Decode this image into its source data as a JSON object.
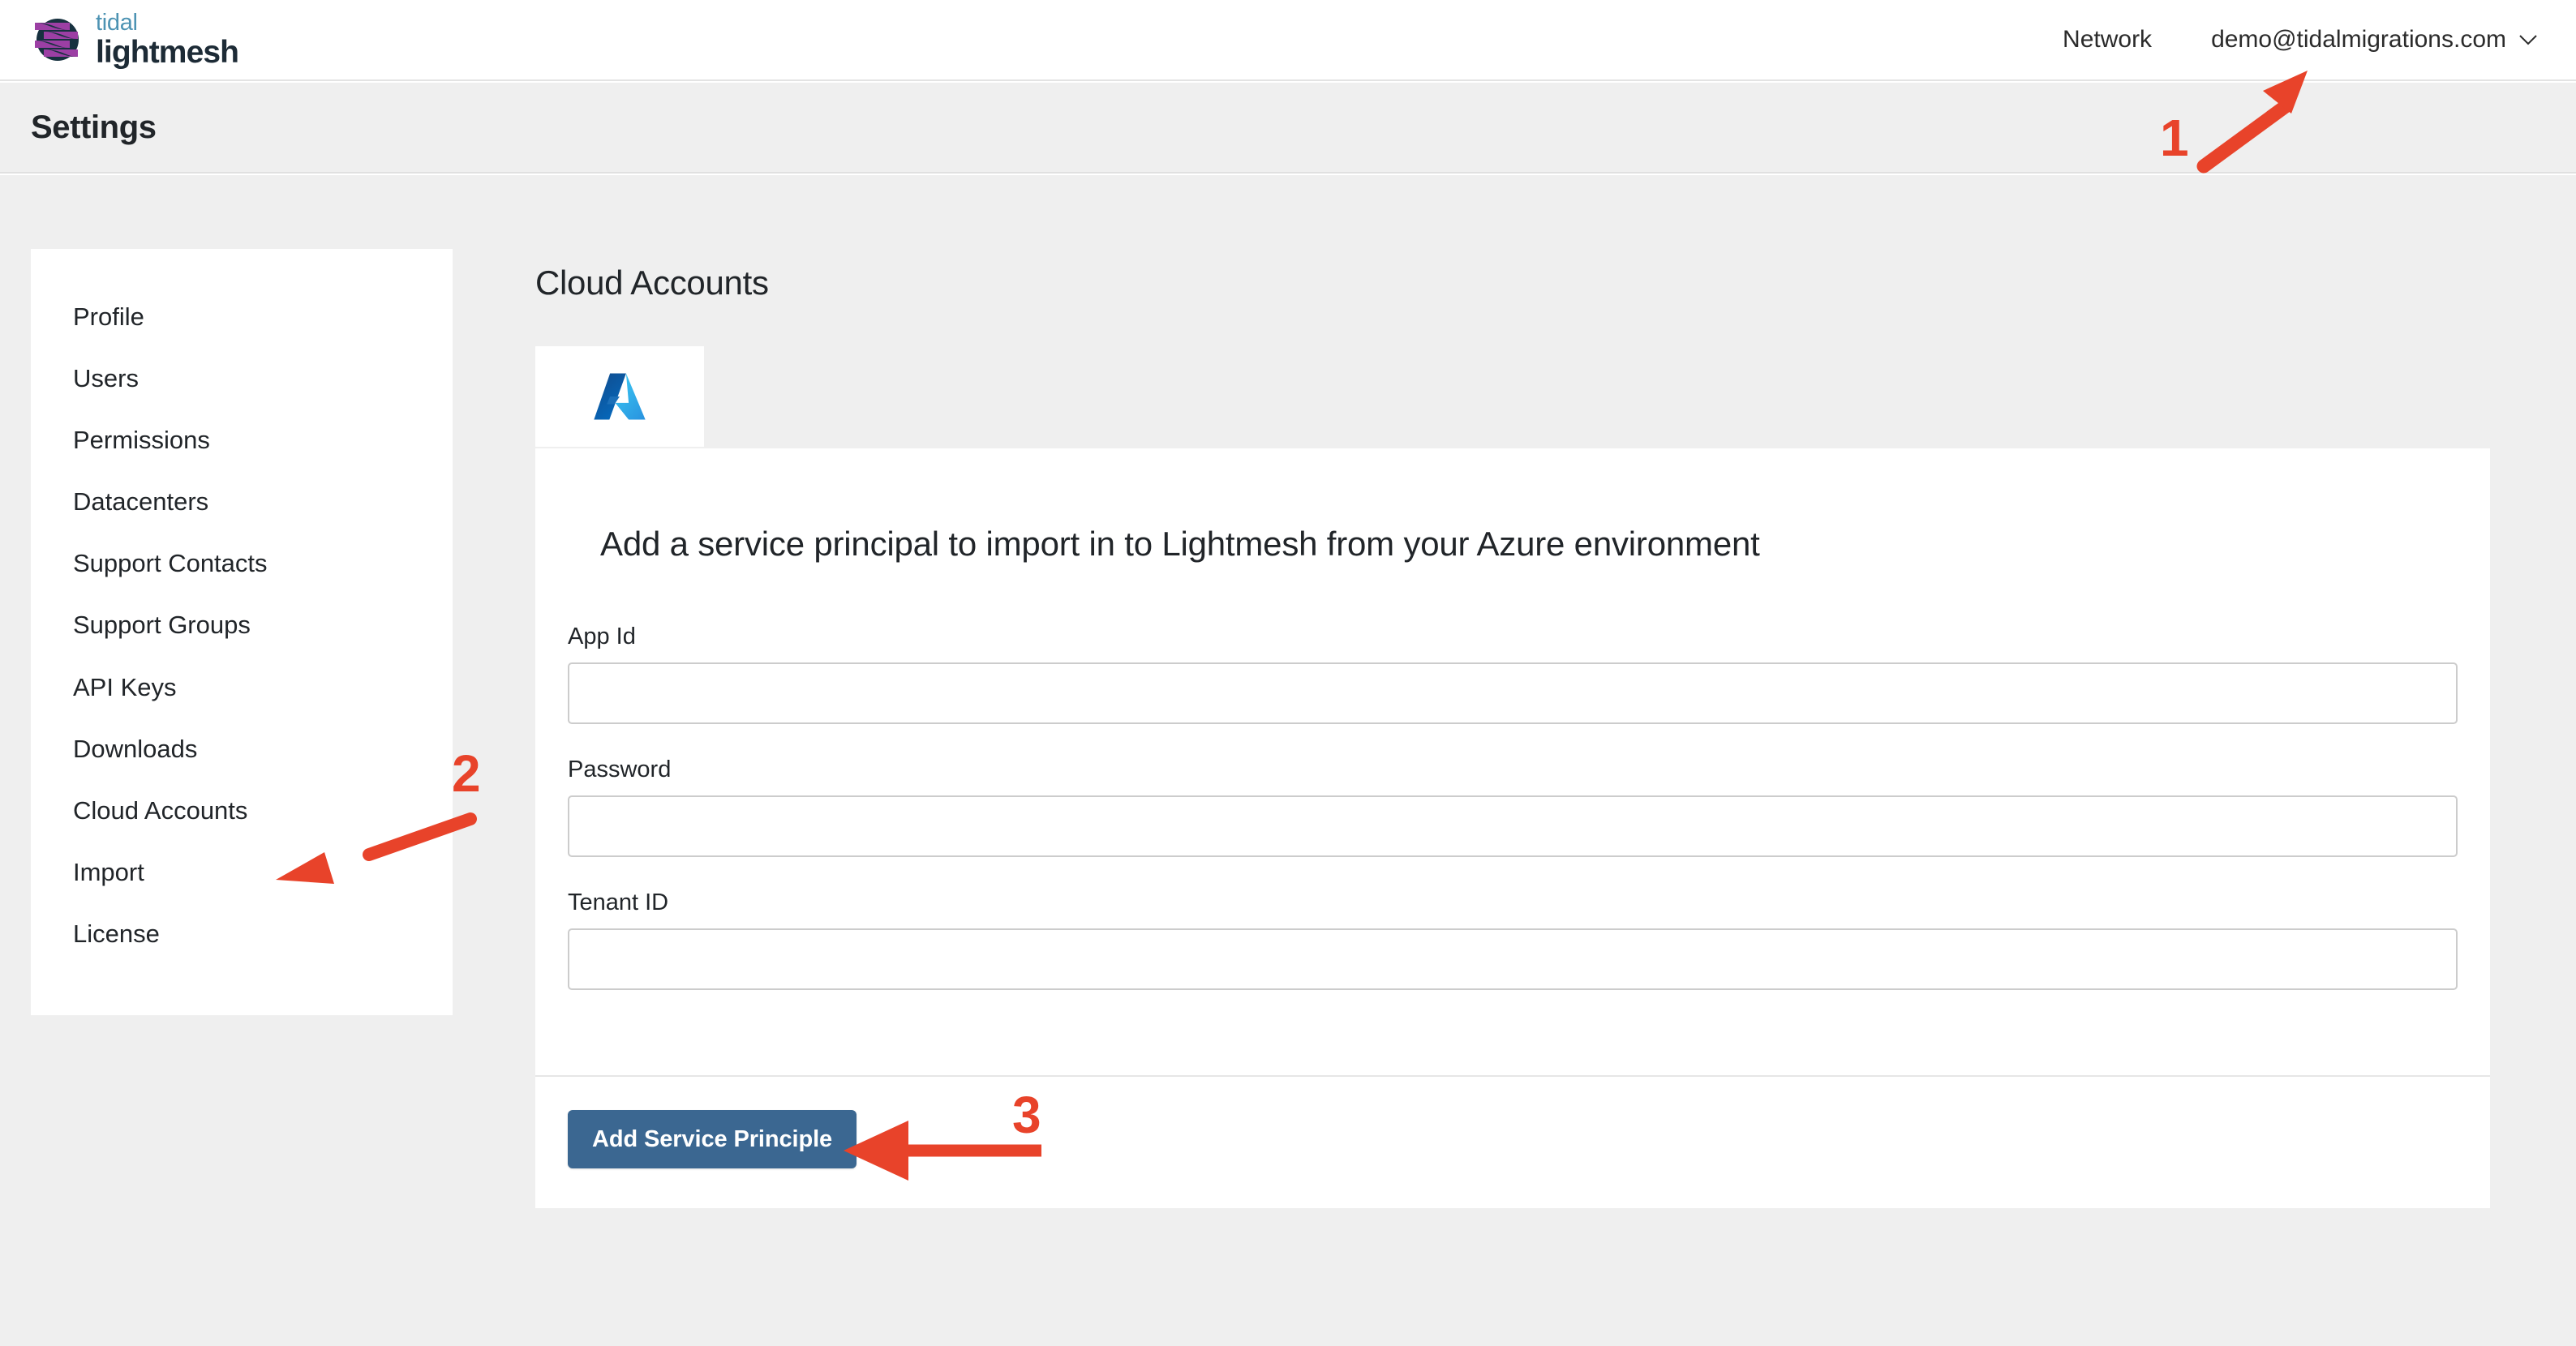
{
  "brand": {
    "logo_icon": "tidal-lightmesh-logo",
    "top_word": "tidal",
    "bottom_word": "lightmesh"
  },
  "topnav": {
    "network_label": "Network",
    "user_email": "demo@tidalmigrations.com",
    "chevron_icon": "chevron-down-icon"
  },
  "header": {
    "title": "Settings"
  },
  "sidebar": {
    "items": [
      {
        "label": "Profile"
      },
      {
        "label": "Users"
      },
      {
        "label": "Permissions"
      },
      {
        "label": "Datacenters"
      },
      {
        "label": "Support Contacts"
      },
      {
        "label": "Support Groups"
      },
      {
        "label": "API Keys"
      },
      {
        "label": "Downloads"
      },
      {
        "label": "Cloud Accounts"
      },
      {
        "label": "Import"
      },
      {
        "label": "License"
      }
    ]
  },
  "main": {
    "title": "Cloud Accounts",
    "tabs": [
      {
        "label": "Azure",
        "icon": "azure-logo-icon",
        "active": true
      }
    ],
    "form": {
      "heading": "Add a service principal to import in to Lightmesh from your Azure environment",
      "fields": [
        {
          "label": "App Id",
          "value": "",
          "placeholder": "",
          "type": "text"
        },
        {
          "label": "Password",
          "value": "",
          "placeholder": "",
          "type": "password"
        },
        {
          "label": "Tenant ID",
          "value": "",
          "placeholder": "",
          "type": "text"
        }
      ],
      "submit_label": "Add Service Principle"
    }
  },
  "annotations": {
    "color": "#e8432a",
    "markers": [
      {
        "number": "1",
        "target": "user-email-dropdown"
      },
      {
        "number": "2",
        "target": "sidebar-item-cloud-accounts"
      },
      {
        "number": "3",
        "target": "add-service-principle-button"
      }
    ]
  },
  "colors": {
    "brand_teal": "#4d93b3",
    "brand_navy": "#1d2b36",
    "brand_purple": "#9c3fa4",
    "button_blue": "#3b6791",
    "annotation_red": "#e8432a",
    "page_background": "#efefef",
    "card_background": "#ffffff"
  }
}
